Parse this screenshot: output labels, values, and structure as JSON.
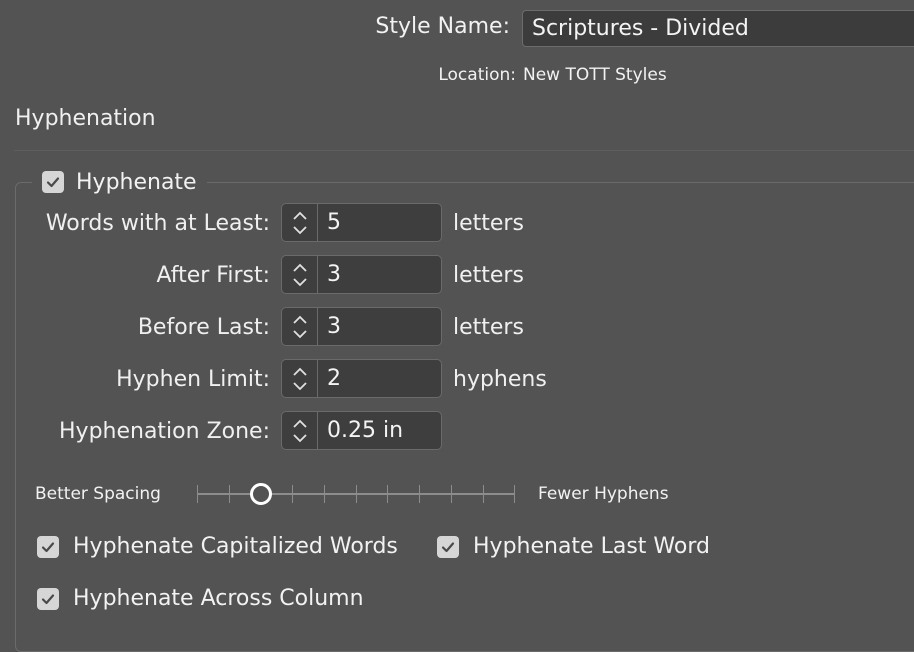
{
  "header": {
    "style_name_label": "Style Name:",
    "style_name_value": "Scriptures - Divided",
    "location_label": "Location:",
    "location_value": "New TOTT Styles"
  },
  "section": {
    "title": "Hyphenation"
  },
  "hyphenate": {
    "label": "Hyphenate",
    "checked": true
  },
  "fields": [
    {
      "label": "Words with at Least:",
      "value": "5",
      "unit": "letters"
    },
    {
      "label": "After First:",
      "value": "3",
      "unit": "letters"
    },
    {
      "label": "Before Last:",
      "value": "3",
      "unit": "letters"
    },
    {
      "label": "Hyphen Limit:",
      "value": "2",
      "unit": "hyphens"
    },
    {
      "label": "Hyphenation Zone:",
      "value": "0.25 in",
      "unit": ""
    }
  ],
  "slider": {
    "left_label": "Better Spacing",
    "right_label": "Fewer Hyphens",
    "position": 0.2
  },
  "options": {
    "capitalized": {
      "label": "Hyphenate Capitalized Words",
      "checked": true
    },
    "last_word": {
      "label": "Hyphenate Last Word",
      "checked": true
    },
    "across_column": {
      "label": "Hyphenate Across Column",
      "checked": true
    }
  },
  "colors": {
    "background": "#535353",
    "field": "#3e3e3e",
    "checkbox": "#d6d6d6"
  }
}
